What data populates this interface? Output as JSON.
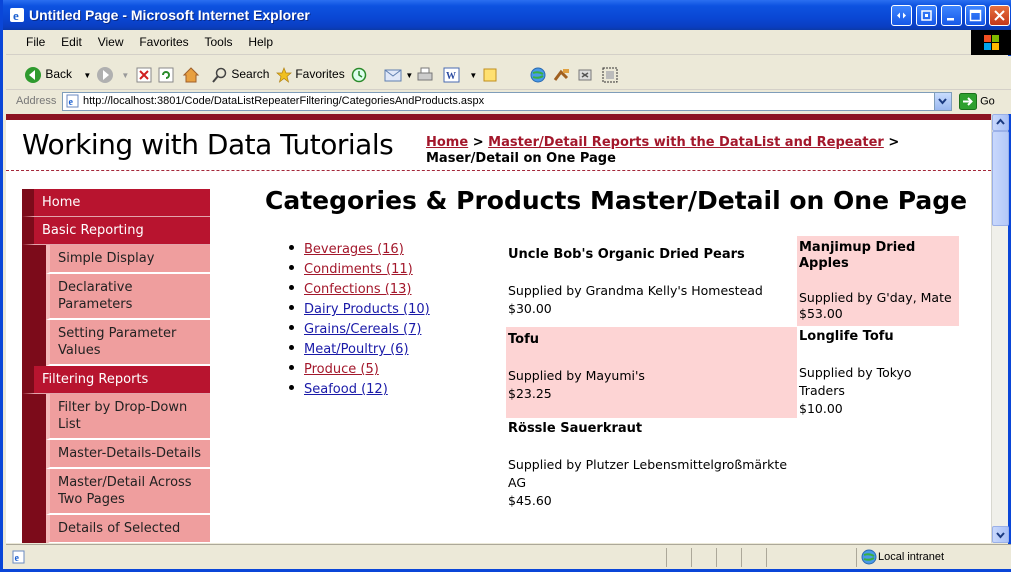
{
  "window": {
    "title": "Untitled Page - Microsoft Internet Explorer"
  },
  "menu": [
    "File",
    "Edit",
    "View",
    "Favorites",
    "Tools",
    "Help"
  ],
  "toolbar": {
    "back_label": "Back",
    "search_label": "Search",
    "favorites_label": "Favorites"
  },
  "address": {
    "label": "Address",
    "url": "http://localhost:3801/Code/DataListRepeaterFiltering/CategoriesAndProducts.aspx",
    "go_label": "Go"
  },
  "site": {
    "title": "Working with Data Tutorials"
  },
  "breadcrumb": {
    "home": "Home",
    "sep1": " > ",
    "parent": "Master/Detail Reports with the DataList and Repeater",
    "sep2": " > ",
    "current": "Maser/Detail on One Page"
  },
  "nav": {
    "home": "Home",
    "basic": "Basic Reporting",
    "basic_items": [
      "Simple Display",
      "Declarative Parameters",
      "Setting Parameter Values"
    ],
    "filtering": "Filtering Reports",
    "filtering_items": [
      "Filter by Drop-Down List",
      "Master-Details-Details",
      "Master/Detail Across Two Pages",
      "Details of Selected"
    ]
  },
  "main": {
    "title": "Categories & Products Master/Detail on One Page"
  },
  "categories": [
    {
      "label": "Beverages (16)",
      "visited": true
    },
    {
      "label": "Condiments (11)",
      "visited": true
    },
    {
      "label": "Confections (13)",
      "visited": true
    },
    {
      "label": "Dairy Products (10)",
      "visited": false
    },
    {
      "label": "Grains/Cereals (7)",
      "visited": false
    },
    {
      "label": "Meat/Poultry (6)",
      "visited": false
    },
    {
      "label": "Produce (5)",
      "visited": true
    },
    {
      "label": "Seafood (12)",
      "visited": false
    }
  ],
  "products": [
    {
      "name": "Uncle Bob's Organic Dried Pears",
      "supplier": "Supplied by Grandma Kelly's Homestead",
      "price": "$30.00"
    },
    {
      "name": "Manjimup Dried Apples",
      "supplier": "Supplied by G'day, Mate",
      "price": "$53.00"
    },
    {
      "name": "Tofu",
      "supplier": "Supplied by Mayumi's",
      "price": "$23.25"
    },
    {
      "name": "Longlife Tofu",
      "supplier": "Supplied by Tokyo Traders",
      "price": "$10.00"
    },
    {
      "name": "Rössle Sauerkraut",
      "supplier": "Supplied by Plutzer Lebensmittelgroßmärkte AG",
      "price": "$45.60"
    }
  ],
  "status": {
    "zone": "Local intranet"
  }
}
